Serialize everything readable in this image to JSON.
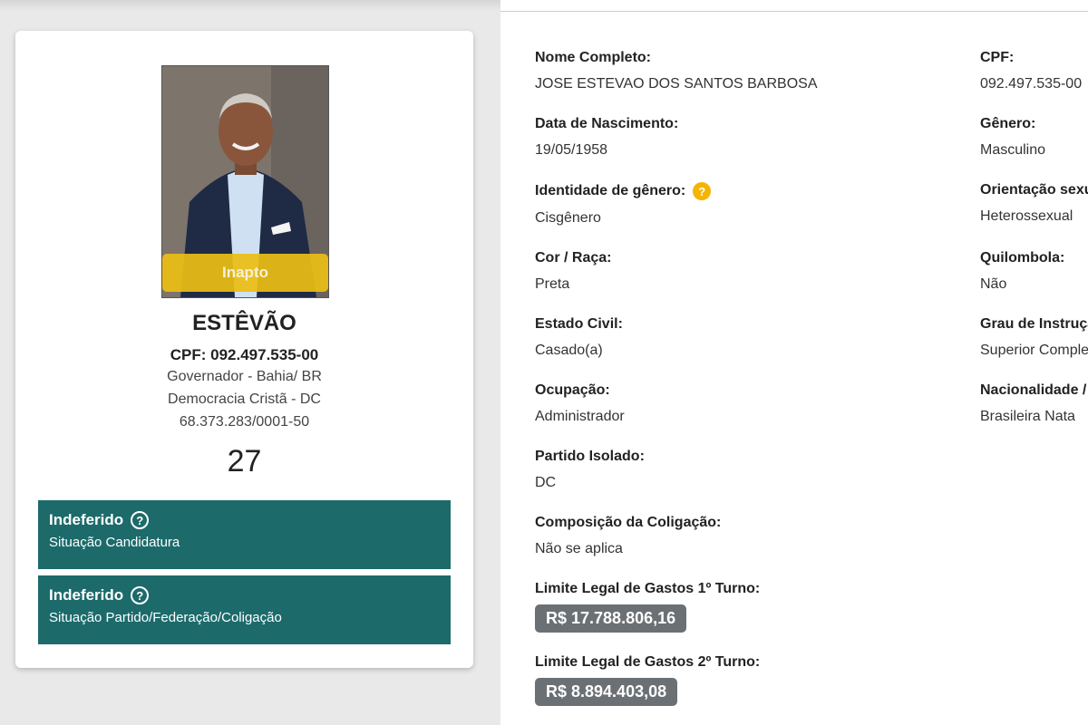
{
  "candidate": {
    "photo_badge": "Inapto",
    "name": "ESTÊVÃO",
    "cpf_line": "CPF: 092.497.535-00",
    "office": "Governador - Bahia/ BR",
    "party": "Democracia Cristã - DC",
    "cnpj": "68.373.283/0001-50",
    "number": "27"
  },
  "status": [
    {
      "title": "Indeferido",
      "subtitle": "Situação Candidatura"
    },
    {
      "title": "Indeferido",
      "subtitle": "Situação Partido/Federação/Coligação"
    }
  ],
  "details": {
    "left": [
      {
        "label": "Nome Completo:",
        "value": "JOSE ESTEVAO DOS SANTOS BARBOSA"
      },
      {
        "label": "Data de Nascimento:",
        "value": "19/05/1958"
      },
      {
        "label": "Identidade de gênero:",
        "value": "Cisgênero"
      },
      {
        "label": "Cor / Raça:",
        "value": "Preta"
      },
      {
        "label": "Estado Civil:",
        "value": "Casado(a)"
      },
      {
        "label": "Ocupação:",
        "value": "Administrador"
      },
      {
        "label": "Partido Isolado:",
        "value": "DC"
      },
      {
        "label": "Composição da Coligação:",
        "value": "Não se aplica"
      },
      {
        "label": "Limite Legal de Gastos 1º Turno:",
        "value": "R$ 17.788.806,16"
      },
      {
        "label": "Limite Legal de Gastos 2º Turno:",
        "value": "R$ 8.894.403,08"
      }
    ],
    "right": [
      {
        "label": "CPF:",
        "value": "092.497.535-00"
      },
      {
        "label": "Gênero:",
        "value": "Masculino"
      },
      {
        "label": "Orientação sexual:",
        "value": "Heterossexual"
      },
      {
        "label": "Quilombola:",
        "value": "Não"
      },
      {
        "label": "Grau de Instrução:",
        "value": "Superior Completo"
      },
      {
        "label": "Nacionalidade / Naturalidade:",
        "value": "Brasileira Nata"
      }
    ]
  },
  "colors": {
    "status_bg": "#1d6a6b",
    "badge_yellow": "#ecbe14",
    "money_bg": "#6b7074",
    "help_orange": "#f4b400"
  }
}
